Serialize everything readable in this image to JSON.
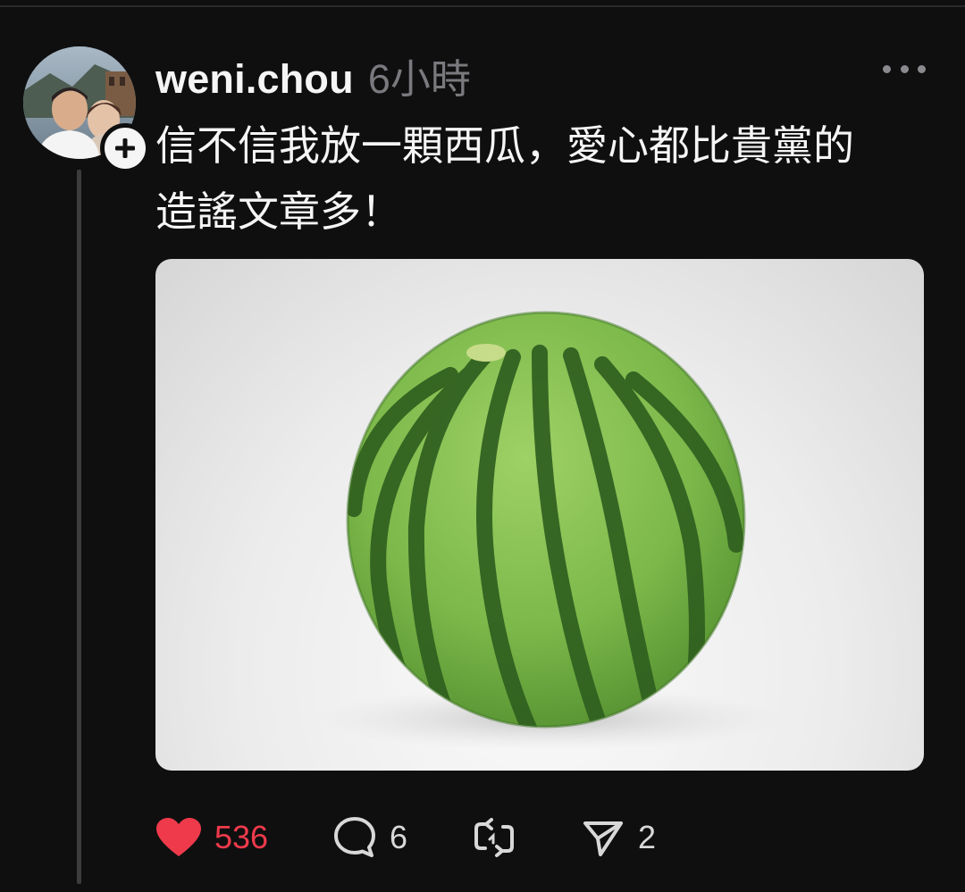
{
  "post": {
    "username": "weni.chou",
    "timestamp": "6小時",
    "text": "信不信我放一顆西瓜，愛心都比貴黨的\n造謠文章多！",
    "image_subject": "watermelon"
  },
  "actions": {
    "likes": "536",
    "replies": "6",
    "reposts": "",
    "shares": "2"
  },
  "icons": {
    "avatar": "avatar-photo",
    "follow": "plus-icon",
    "more": "more-horizontal-icon",
    "like": "heart-filled-icon",
    "reply": "comment-bubble-icon",
    "repost": "repost-icon",
    "share": "send-icon"
  },
  "colors": {
    "background": "#0f0f10",
    "like_active": "#ef3a4b",
    "muted_text": "#7a7a7e",
    "thread_line": "#3c3c3e"
  }
}
